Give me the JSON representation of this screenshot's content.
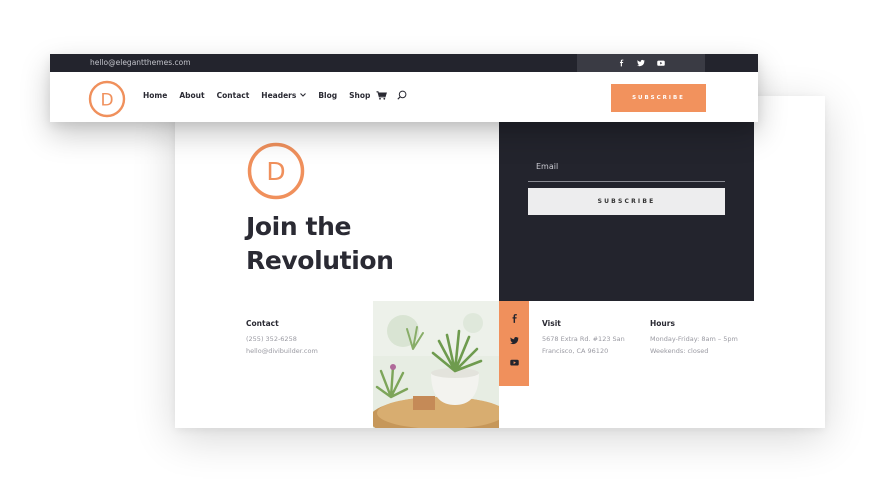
{
  "colors": {
    "accent": "#f2925d",
    "dark": "#23242d",
    "text": "#2a2a33",
    "muted": "#9a9aa2"
  },
  "topbar": {
    "email": "hello@elegantthemes.com",
    "social_icons": [
      "facebook-icon",
      "twitter-icon",
      "youtube-icon"
    ]
  },
  "logo": {
    "letter": "D"
  },
  "nav": {
    "items": [
      {
        "label": "Home"
      },
      {
        "label": "About"
      },
      {
        "label": "Contact"
      },
      {
        "label": "Headers",
        "has_dropdown": true
      },
      {
        "label": "Blog"
      },
      {
        "label": "Shop"
      }
    ],
    "icons": [
      "cart-icon",
      "search-icon"
    ]
  },
  "header": {
    "subscribe_label": "SUBSCRIBE"
  },
  "hero": {
    "headline_line1": "Join the",
    "headline_line2": "Revolution"
  },
  "newsletter": {
    "email_placeholder": "Email",
    "subscribe_label": "SUBSCRIBE"
  },
  "footer": {
    "contact": {
      "title": "Contact",
      "phone": "(255) 352-6258",
      "email": "hello@divibuilder.com"
    },
    "social_icons": [
      "facebook-icon",
      "twitter-icon",
      "youtube-icon"
    ],
    "visit": {
      "title": "Visit",
      "line1": "5678 Extra Rd. #123 San",
      "line2": "Francisco, CA 96120"
    },
    "hours": {
      "title": "Hours",
      "line1": "Monday-Friday: 8am – 5pm",
      "line2": "Weekends: closed"
    }
  }
}
